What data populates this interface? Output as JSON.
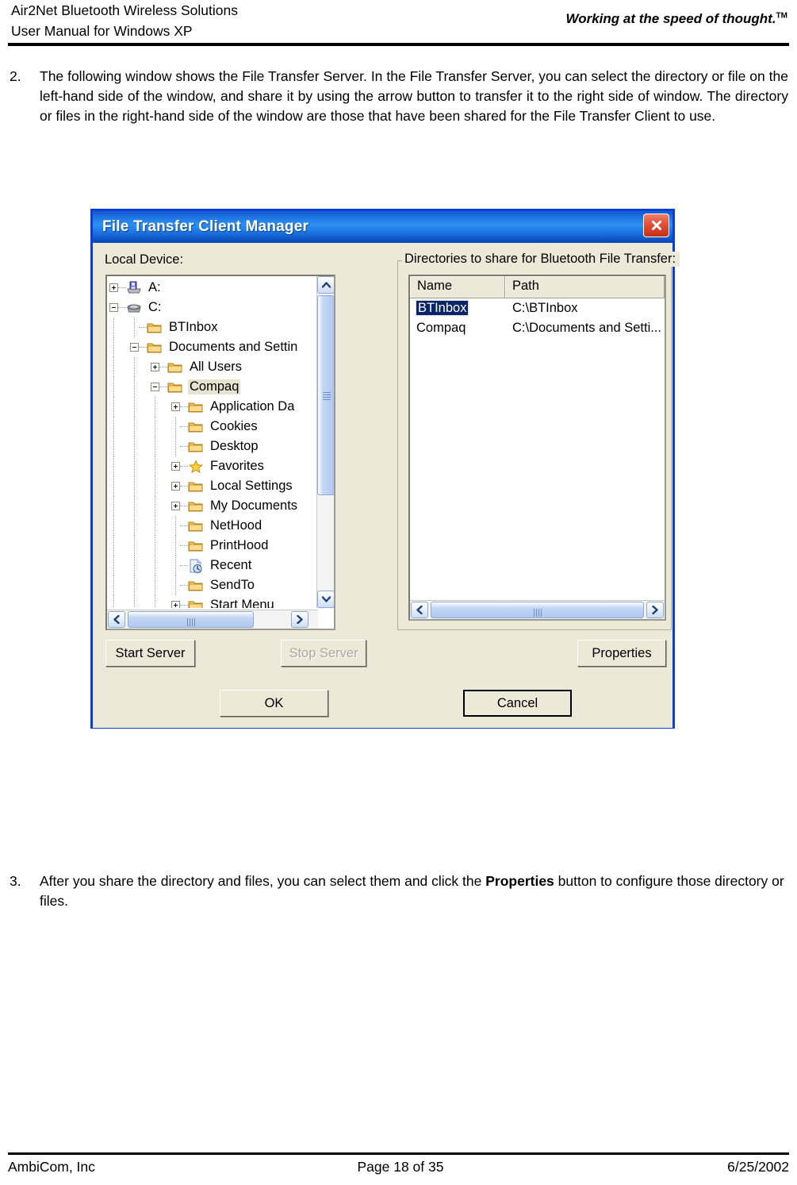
{
  "header": {
    "left_line1": "Air2Net Bluetooth Wireless Solutions",
    "left_line2": "User Manual for Windows XP",
    "tagline": "Working at the speed of thought.",
    "tagline_tm": "TM"
  },
  "steps": [
    {
      "number": "2.",
      "text": "The following window shows the File Transfer Server. In the File Transfer Server, you can select the directory or file on the left-hand side of the window, and share it by using the arrow button to transfer it to the right side of window. The directory or files in the right-hand side of the window are those that have been shared for the File Transfer Client to use."
    },
    {
      "number": "3.",
      "text_before": "After you share the directory and files, you can select them and click the ",
      "bold": "Properties",
      "text_after": " button to configure those directory or files."
    }
  ],
  "dialog": {
    "title": "File Transfer Client  Manager",
    "close_icon": "close-icon",
    "local_device_label": "Local Device:",
    "tree": [
      {
        "label": "A:",
        "indent": 0,
        "toggle": "plus",
        "icon": "floppy-drive-icon",
        "selected": false
      },
      {
        "label": "C:",
        "indent": 0,
        "toggle": "minus",
        "icon": "hard-drive-icon",
        "selected": false
      },
      {
        "label": "BTInbox",
        "indent": 1,
        "toggle": "none",
        "icon": "folder-icon",
        "selected": false
      },
      {
        "label": "Documents and Settin",
        "indent": 1,
        "toggle": "minus",
        "icon": "folder-icon",
        "selected": false
      },
      {
        "label": "All Users",
        "indent": 2,
        "toggle": "plus",
        "icon": "folder-icon",
        "selected": false
      },
      {
        "label": "Compaq",
        "indent": 2,
        "toggle": "minus",
        "icon": "folder-open-icon",
        "selected": true
      },
      {
        "label": "Application Da",
        "indent": 3,
        "toggle": "plus",
        "icon": "folder-icon",
        "selected": false
      },
      {
        "label": "Cookies",
        "indent": 3,
        "toggle": "none",
        "icon": "folder-icon",
        "selected": false
      },
      {
        "label": "Desktop",
        "indent": 3,
        "toggle": "none",
        "icon": "folder-icon",
        "selected": false
      },
      {
        "label": "Favorites",
        "indent": 3,
        "toggle": "plus",
        "icon": "star-folder-icon",
        "selected": false
      },
      {
        "label": "Local Settings",
        "indent": 3,
        "toggle": "plus",
        "icon": "folder-icon",
        "selected": false
      },
      {
        "label": "My Documents",
        "indent": 3,
        "toggle": "plus",
        "icon": "folder-icon",
        "selected": false
      },
      {
        "label": "NetHood",
        "indent": 3,
        "toggle": "none",
        "icon": "folder-icon",
        "selected": false
      },
      {
        "label": "PrintHood",
        "indent": 3,
        "toggle": "none",
        "icon": "folder-icon",
        "selected": false
      },
      {
        "label": "Recent",
        "indent": 3,
        "toggle": "none",
        "icon": "recent-document-icon",
        "selected": false
      },
      {
        "label": "SendTo",
        "indent": 3,
        "toggle": "none",
        "icon": "folder-icon",
        "selected": false
      },
      {
        "label": "Start Menu",
        "indent": 3,
        "toggle": "plus",
        "icon": "folder-icon",
        "selected": false
      }
    ],
    "transfer_right_label": "==>",
    "transfer_left_label": "<==",
    "share_group_label": "Directories to share for Bluetooth File Transfer:",
    "share_columns": [
      "Name",
      "Path"
    ],
    "share_rows": [
      {
        "name": "BTInbox",
        "path": "C:\\BTInbox",
        "selected": true
      },
      {
        "name": "Compaq",
        "path": "C:\\Documents and Setti...",
        "selected": false
      }
    ],
    "buttons": {
      "start_server": "Start Server",
      "stop_server": "Stop Server",
      "properties": "Properties",
      "ok": "OK",
      "cancel": "Cancel"
    },
    "colors": {
      "titlebar_blue": "#1b6fe0",
      "window_border": "#0a3fd6",
      "face": "#ece9d8",
      "selection_blue": "#0a246a",
      "close_red": "#c62d16"
    }
  },
  "footer": {
    "company": "AmbiCom, Inc",
    "page": "Page 18 of 35",
    "date": "6/25/2002"
  }
}
